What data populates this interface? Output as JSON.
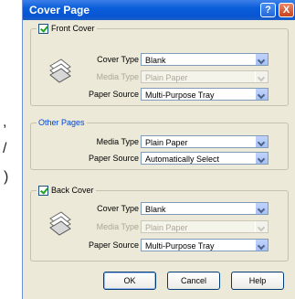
{
  "background_fragments": [
    ",",
    "/",
    ")"
  ],
  "window": {
    "title": "Cover Page",
    "help_glyph": "?",
    "close_glyph": "X"
  },
  "front_cover": {
    "legend": "Front Cover",
    "checked": true,
    "fields": [
      {
        "label": "Cover Type :",
        "value": "Blank",
        "enabled": true
      },
      {
        "label": "Media Type :",
        "value": "Plain Paper",
        "enabled": false
      },
      {
        "label": "Paper Source :",
        "value": "Multi-Purpose Tray",
        "enabled": true
      }
    ]
  },
  "other_pages": {
    "legend": "Other Pages",
    "fields": [
      {
        "label": "Media Type :",
        "value": "Plain Paper",
        "enabled": true
      },
      {
        "label": "Paper Source :",
        "value": "Automatically Select",
        "enabled": true
      }
    ]
  },
  "back_cover": {
    "legend": "Back Cover",
    "checked": true,
    "fields": [
      {
        "label": "Cover Type :",
        "value": "Blank",
        "enabled": true
      },
      {
        "label": "Media Type :",
        "value": "Plain Paper",
        "enabled": false
      },
      {
        "label": "Paper Source :",
        "value": "Multi-Purpose Tray",
        "enabled": true
      }
    ]
  },
  "buttons": {
    "ok": "OK",
    "cancel": "Cancel",
    "help": "Help"
  },
  "colors": {
    "title_bar": "#0a5ed9",
    "dialog_bg": "#ece9d8",
    "group_legend": "#0046d5",
    "disabled_text": "#aca899"
  }
}
